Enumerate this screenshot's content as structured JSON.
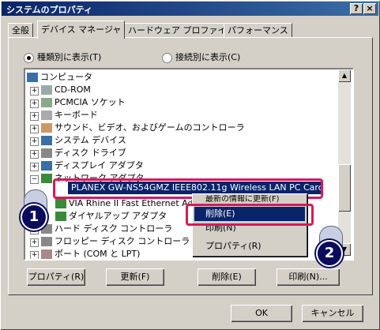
{
  "window": {
    "title": "システムのプロパティ",
    "help_btn": "?",
    "close_btn": "×"
  },
  "tabs": [
    "全般",
    "デバイス マネージャ",
    "ハードウェア プロファイル",
    "パフォーマンス"
  ],
  "view": {
    "by_type": "種類別に表示(T)",
    "by_connection": "接続別に表示(C)"
  },
  "tree": {
    "root": "コンピュータ",
    "items": [
      "CD-ROM",
      "PCMCIA ソケット",
      "キーボード",
      "サウンド、ビデオ、およびゲームのコントローラ",
      "システム デバイス",
      "ディスク ドライブ",
      "ディスプレイ アダプタ",
      "ネットワーク アダプタ"
    ],
    "network_children": [
      "PLANEX GW-NS54GMZ IEEE802.11g Wireless LAN PC Card",
      "VIA Rhine II Fast Ethernet Ad",
      "ダイヤルアップ アダプタ"
    ],
    "after": [
      "ハード ディスク コントローラ",
      "フロッピー ディスク コントローラ",
      "ポート (COM と LPT)"
    ]
  },
  "context_menu": {
    "refresh_partial": "最新の情報に更新(F)",
    "delete": "削除(E)",
    "print": "印刷(N)",
    "properties": "プロパティ(R)"
  },
  "buttons": {
    "properties": "プロパティ(R)",
    "refresh": "更新(F)",
    "delete": "削除(E)",
    "print": "印刷(N)...",
    "ok": "OK",
    "cancel": "キャンセル"
  },
  "badges": {
    "one": "1",
    "two": "2"
  },
  "colors": {
    "highlight": "#d6195a",
    "selection": "#0a246a"
  }
}
